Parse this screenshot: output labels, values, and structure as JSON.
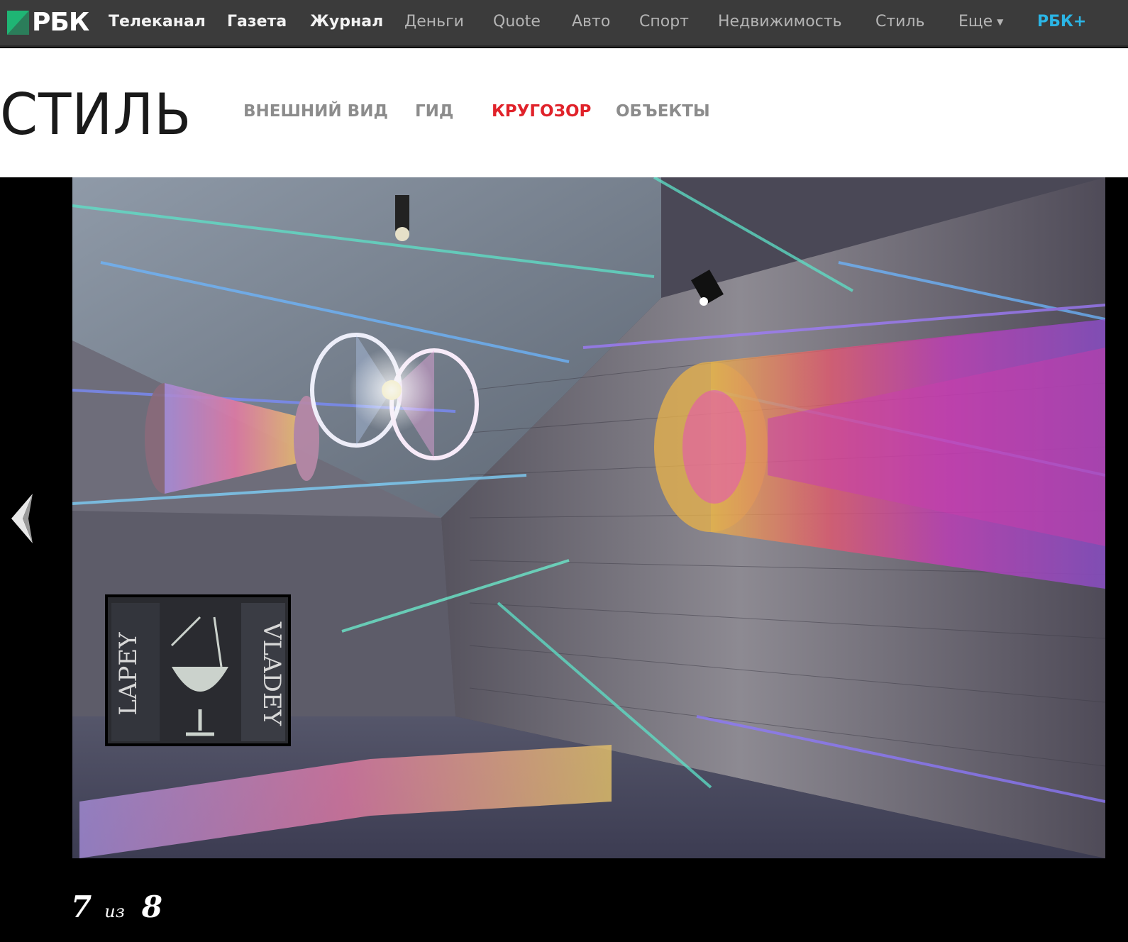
{
  "topbar": {
    "logo_text": "РБК",
    "nav": [
      {
        "label": "Телеканал",
        "style": "strong"
      },
      {
        "label": "Газета",
        "style": "strong"
      },
      {
        "label": "Журнал",
        "style": "strong"
      },
      {
        "label": "Деньги",
        "style": "dim"
      },
      {
        "label": "Quote",
        "style": "dim"
      },
      {
        "label": "Авто",
        "style": "dim"
      },
      {
        "label": "Спорт",
        "style": "dim"
      },
      {
        "label": "Недвижимость",
        "style": "dim"
      },
      {
        "label": "Стиль",
        "style": "dim"
      },
      {
        "label": "Еще",
        "style": "dim"
      },
      {
        "label": "РБК+",
        "style": "accent"
      }
    ],
    "colors": {
      "background": "#3b3b3b",
      "accent": "#2bb5e5",
      "logo_green": "#1fb574"
    }
  },
  "section": {
    "title": "СТИЛЬ",
    "tabs": [
      {
        "label": "ВНЕШНИЙ ВИД",
        "active": false
      },
      {
        "label": "ГИД",
        "active": false
      },
      {
        "label": "КРУГОЗОР",
        "active": true
      },
      {
        "label": "ОБЪЕКТЫ",
        "active": false
      }
    ],
    "active_color": "#e0222a"
  },
  "gallery": {
    "current": "7",
    "of_label": "из",
    "total": "8",
    "photo_text": {
      "left_word": "LAPEY",
      "right_word": "VLADEY"
    }
  }
}
